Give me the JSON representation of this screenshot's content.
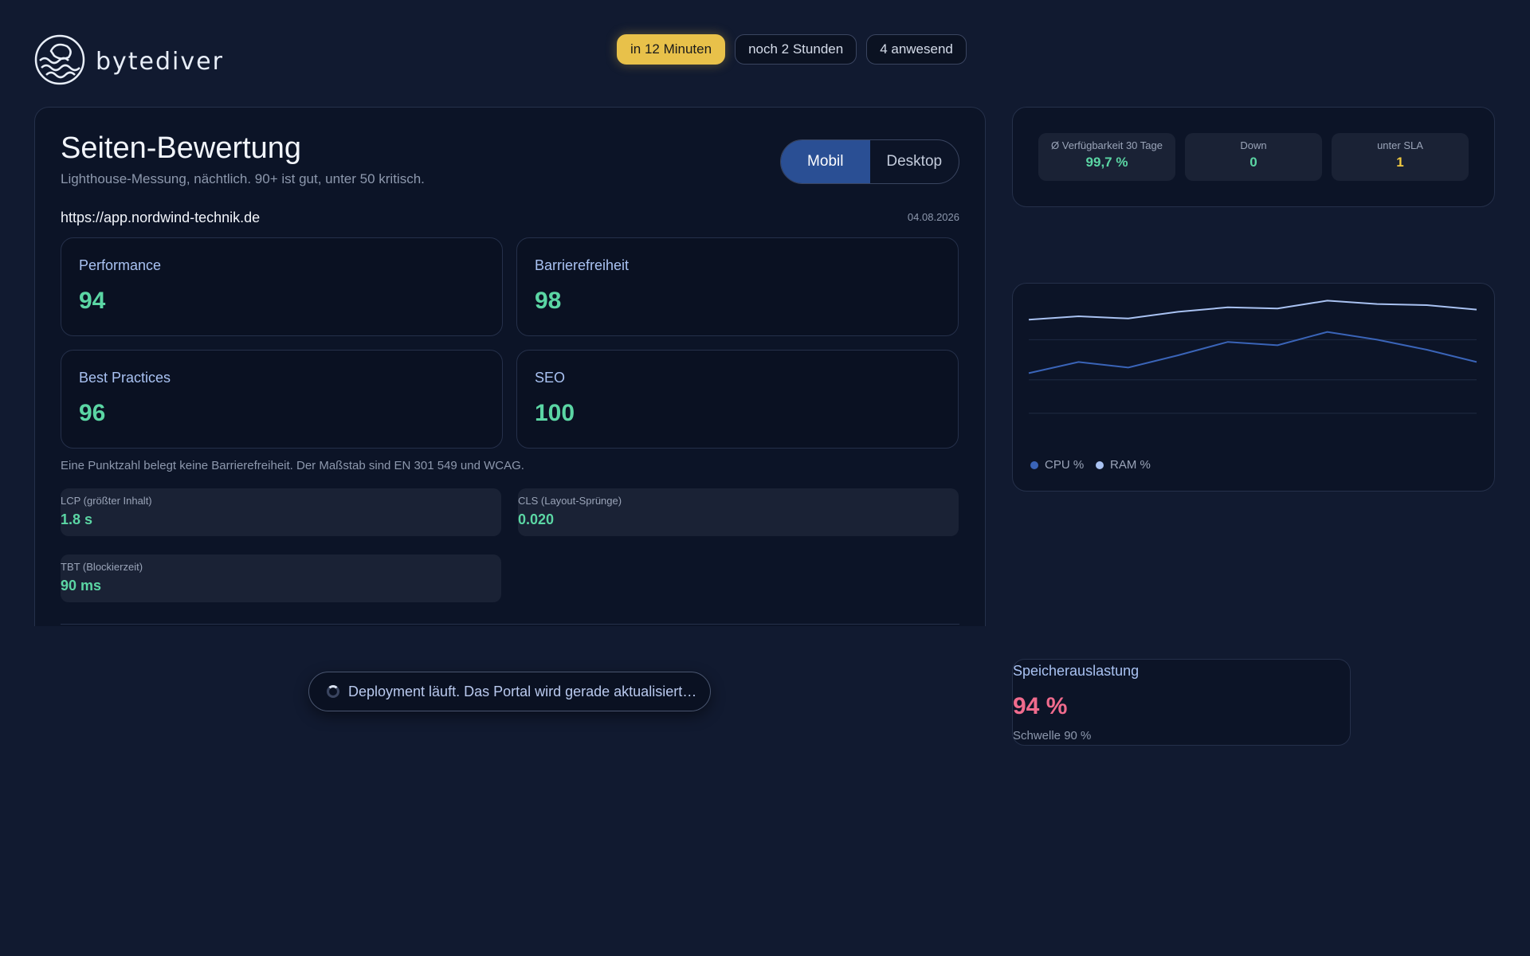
{
  "brand": {
    "name": "bytediver",
    "logo_icon": "diver-helmet-waves-icon"
  },
  "status_pills": [
    {
      "label": "in 12 Minuten",
      "active": true
    },
    {
      "label": "noch 2 Stunden",
      "active": false
    },
    {
      "label": "4 anwesend",
      "active": false
    }
  ],
  "page_score": {
    "title": "Seiten-Bewertung",
    "subtitle": "Lighthouse-Messung, nächtlich. 90+ ist gut, unter 50 kritisch.",
    "toggle": {
      "options": [
        "Mobil",
        "Desktop"
      ],
      "selected": "Mobil"
    },
    "url": "https://app.nordwind-technik.de",
    "date": "04.08.2026",
    "scores": [
      {
        "label": "Performance",
        "value": "94"
      },
      {
        "label": "Barrierefreiheit",
        "value": "98"
      },
      {
        "label": "Best Practices",
        "value": "96"
      },
      {
        "label": "SEO",
        "value": "100"
      }
    ],
    "note": "Eine Punktzahl belegt keine Barrierefreiheit. Der Maßstab sind EN 301 549 und WCAG.",
    "metrics": [
      {
        "label": "LCP (größter Inhalt)",
        "value": "1.8 s"
      },
      {
        "label": "CLS (Layout-Sprünge)",
        "value": "0.020"
      },
      {
        "label": "TBT (Blockierzeit)",
        "value": "90 ms"
      }
    ]
  },
  "sla": [
    {
      "label": "Ø Verfügbarkeit 30 Tage",
      "value": "99,7 %",
      "color": "#5bd6a4"
    },
    {
      "label": "Down",
      "value": "0",
      "color": "#5bd6a4"
    },
    {
      "label": "unter SLA",
      "value": "1",
      "color": "#f0c940"
    }
  ],
  "chart_data": {
    "type": "line",
    "x": [
      1,
      2,
      3,
      4,
      5,
      6,
      7,
      8,
      9,
      10
    ],
    "ylim": [
      0,
      100
    ],
    "grid": true,
    "legend_position": "bottom-left",
    "series": [
      {
        "name": "CPU %",
        "color": "#3a64b8",
        "values": [
          34,
          44,
          39,
          50,
          62,
          59,
          71,
          64,
          55,
          44
        ]
      },
      {
        "name": "RAM %",
        "color": "#a9c2f2",
        "values": [
          82,
          85,
          83,
          89,
          93,
          92,
          99,
          96,
          95,
          91
        ]
      }
    ]
  },
  "storage": {
    "label": "Speicherauslastung",
    "value": "94 %",
    "threshold": "Schwelle 90 %",
    "value_color": "#f06b8d"
  },
  "toast": {
    "text": "Deployment läuft. Das Portal wird gerade aktualisiert…",
    "icon": "spinner-icon"
  }
}
